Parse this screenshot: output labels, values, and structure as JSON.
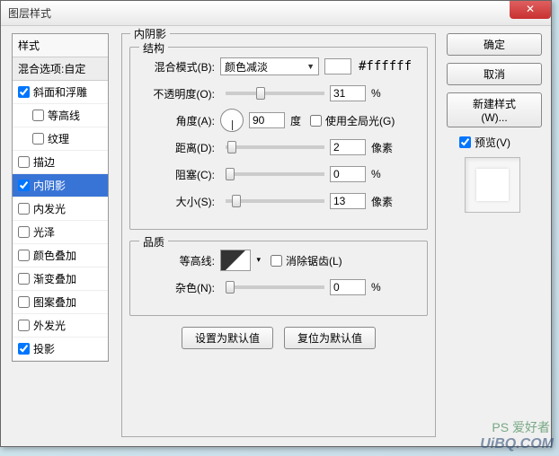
{
  "window": {
    "title": "图层样式"
  },
  "sidebar": {
    "header": "样式",
    "sub": "混合选项:自定",
    "items": [
      {
        "label": "斜面和浮雕",
        "checked": true,
        "indent": false
      },
      {
        "label": "等高线",
        "checked": false,
        "indent": true
      },
      {
        "label": "纹理",
        "checked": false,
        "indent": true
      },
      {
        "label": "描边",
        "checked": false,
        "indent": false
      },
      {
        "label": "内阴影",
        "checked": true,
        "indent": false,
        "selected": true
      },
      {
        "label": "内发光",
        "checked": false,
        "indent": false
      },
      {
        "label": "光泽",
        "checked": false,
        "indent": false
      },
      {
        "label": "颜色叠加",
        "checked": false,
        "indent": false
      },
      {
        "label": "渐变叠加",
        "checked": false,
        "indent": false
      },
      {
        "label": "图案叠加",
        "checked": false,
        "indent": false
      },
      {
        "label": "外发光",
        "checked": false,
        "indent": false
      },
      {
        "label": "投影",
        "checked": true,
        "indent": false
      }
    ]
  },
  "panel": {
    "title": "内阴影",
    "structure": {
      "legend": "结构",
      "blend_label": "混合模式(B):",
      "blend_value": "颜色减淡",
      "hex": "#ffffff",
      "opacity_label": "不透明度(O):",
      "opacity_value": "31",
      "opacity_unit": "%",
      "angle_label": "角度(A):",
      "angle_value": "90",
      "angle_unit": "度",
      "global_light": "使用全局光(G)",
      "distance_label": "距离(D):",
      "distance_value": "2",
      "distance_unit": "像素",
      "choke_label": "阻塞(C):",
      "choke_value": "0",
      "choke_unit": "%",
      "size_label": "大小(S):",
      "size_value": "13",
      "size_unit": "像素"
    },
    "quality": {
      "legend": "品质",
      "contour_label": "等高线:",
      "antialias": "消除锯齿(L)",
      "noise_label": "杂色(N):",
      "noise_value": "0",
      "noise_unit": "%"
    },
    "buttons": {
      "default": "设置为默认值",
      "reset": "复位为默认值"
    }
  },
  "right": {
    "ok": "确定",
    "cancel": "取消",
    "new_style": "新建样式(W)...",
    "preview": "预览(V)"
  },
  "watermark": {
    "line1": "PS 爱好者",
    "line2": "UiBQ.COM"
  }
}
